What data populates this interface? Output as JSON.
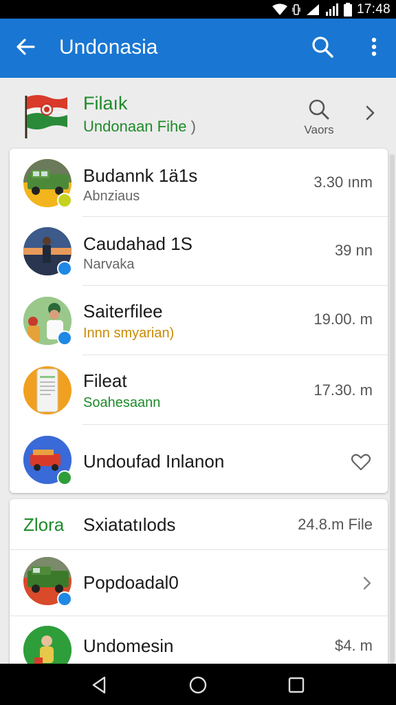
{
  "status_bar": {
    "time": "17:48"
  },
  "app_bar": {
    "title": "Undonasia"
  },
  "info_header": {
    "title": "Filaık",
    "subtitle": "Undonaan Fihe",
    "subtitle_after": " )",
    "search_label": "Vaors"
  },
  "list_card": {
    "rows": [
      {
        "title": "Budannk 1ä1s",
        "subtitle": "Abnziaus",
        "time": "3.30 ınm"
      },
      {
        "title": "Caudahad 1S",
        "subtitle": "Narvaka",
        "time": "39  nn"
      },
      {
        "title": "Saiterfilee",
        "subtitle": "Innn smyarian)",
        "time": "19.00. m"
      },
      {
        "title": "Fileat",
        "subtitle": "Soahesaann",
        "time": "17.30. m"
      },
      {
        "title": "Undoufad Inlanon"
      }
    ]
  },
  "files_card": {
    "header": {
      "label": "Zlora",
      "title": "Sxiatatılods",
      "size": "24.8.m File"
    },
    "rows": [
      {
        "title": "Popdoadal0"
      },
      {
        "title": "Undomesin",
        "size": "$4. m"
      }
    ]
  },
  "colors": {
    "app_bar": "#1976d2",
    "green_accent": "#1e8a2a",
    "gold_accent": "#c98a00",
    "badge_blue": "#1e88e5",
    "badge_green": "#2e9e3a",
    "badge_yellow": "#c6d21d"
  },
  "icons": [
    "back-arrow-icon",
    "search-icon",
    "more-vert-icon",
    "flag-icon",
    "chevron-right-icon",
    "heart-icon",
    "nav-back-icon",
    "nav-home-icon",
    "nav-recents-icon"
  ]
}
